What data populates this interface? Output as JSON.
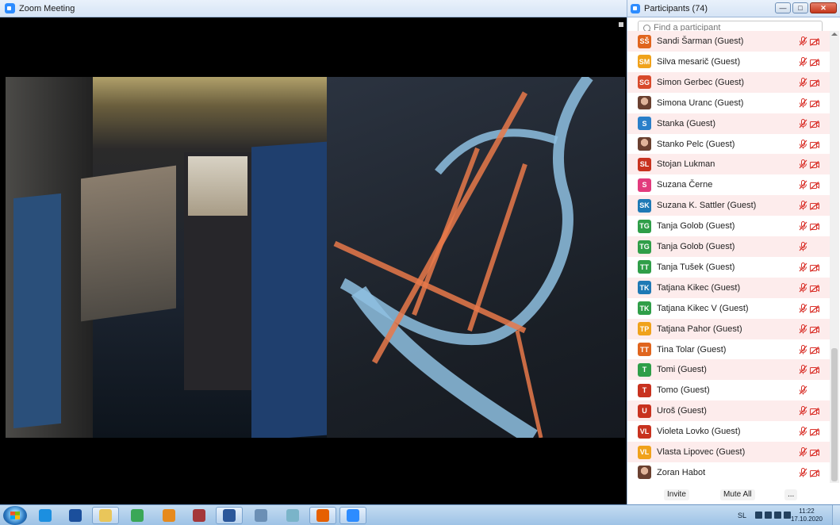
{
  "meeting_window": {
    "title": "Zoom Meeting"
  },
  "participants_panel": {
    "title": "Participants (74)",
    "search_placeholder": "Find a participant",
    "participants": [
      {
        "initials": "SŠ",
        "name": "Sandi Šarman (Guest)",
        "color": "#e0651e",
        "mic_muted": true,
        "video_off": true
      },
      {
        "initials": "SM",
        "name": "Silva mesarič (Guest)",
        "color": "#f0a21c",
        "mic_muted": true,
        "video_off": true
      },
      {
        "initials": "SG",
        "name": "Simon Gerbec (Guest)",
        "color": "#d84a2b",
        "mic_muted": true,
        "video_off": true
      },
      {
        "initials": "",
        "name": "Simona Uranc (Guest)",
        "color": "photo",
        "mic_muted": true,
        "video_off": true
      },
      {
        "initials": "S",
        "name": "Stanka (Guest)",
        "color": "#2a7fc9",
        "mic_muted": true,
        "video_off": true
      },
      {
        "initials": "",
        "name": "Stanko Pelc (Guest)",
        "color": "photo",
        "mic_muted": true,
        "video_off": true
      },
      {
        "initials": "SL",
        "name": "Stojan Lukman",
        "color": "#c8321f",
        "mic_muted": true,
        "video_off": true
      },
      {
        "initials": "S",
        "name": "Suzana Černe",
        "color": "#e23b7d",
        "mic_muted": true,
        "video_off": true
      },
      {
        "initials": "SK",
        "name": "Suzana K. Sattler (Guest)",
        "color": "#1e79b5",
        "mic_muted": true,
        "video_off": true
      },
      {
        "initials": "TG",
        "name": "Tanja Golob (Guest)",
        "color": "#2f9e48",
        "mic_muted": true,
        "video_off": true
      },
      {
        "initials": "TG",
        "name": "Tanja Golob (Guest)",
        "color": "#2f9e48",
        "mic_muted": true,
        "video_off": false
      },
      {
        "initials": "TT",
        "name": "Tanja Tušek (Guest)",
        "color": "#2f9e48",
        "mic_muted": true,
        "video_off": true
      },
      {
        "initials": "TK",
        "name": "Tatjana Kikec (Guest)",
        "color": "#1e79b5",
        "mic_muted": true,
        "video_off": true
      },
      {
        "initials": "TK",
        "name": "Tatjana Kikec V (Guest)",
        "color": "#2f9e48",
        "mic_muted": true,
        "video_off": true
      },
      {
        "initials": "TP",
        "name": "Tatjana Pahor (Guest)",
        "color": "#f0a21c",
        "mic_muted": true,
        "video_off": true
      },
      {
        "initials": "TT",
        "name": "Tina Tolar (Guest)",
        "color": "#e0651e",
        "mic_muted": true,
        "video_off": true
      },
      {
        "initials": "T",
        "name": "Tomi (Guest)",
        "color": "#2f9e48",
        "mic_muted": true,
        "video_off": true
      },
      {
        "initials": "T",
        "name": "Tomo (Guest)",
        "color": "#c8321f",
        "mic_muted": true,
        "video_off": false
      },
      {
        "initials": "U",
        "name": "Uroš (Guest)",
        "color": "#c8321f",
        "mic_muted": true,
        "video_off": true
      },
      {
        "initials": "VL",
        "name": "Violeta Lovko (Guest)",
        "color": "#c8321f",
        "mic_muted": true,
        "video_off": true
      },
      {
        "initials": "VL",
        "name": "Vlasta Lipovec (Guest)",
        "color": "#f0a21c",
        "mic_muted": true,
        "video_off": true
      },
      {
        "initials": "",
        "name": "Zoran Habot",
        "color": "photo",
        "mic_muted": true,
        "video_off": true
      }
    ],
    "footer": {
      "invite_label": "Invite",
      "mute_all_label": "Mute All",
      "more_label": "..."
    }
  },
  "taskbar": {
    "apps": [
      {
        "name": "internet-explorer-icon",
        "color": "#1c8fe0"
      },
      {
        "name": "google-earth-icon",
        "color": "#1b4f9c"
      },
      {
        "name": "file-explorer-icon",
        "color": "#e9c65a"
      },
      {
        "name": "chrome-icon",
        "color": "#3aa757"
      },
      {
        "name": "outlook-icon",
        "color": "#e68a1e"
      },
      {
        "name": "access-icon",
        "color": "#a4373a"
      },
      {
        "name": "word-icon",
        "color": "#2b579a"
      },
      {
        "name": "calculator-icon",
        "color": "#6b8fb5"
      },
      {
        "name": "notes-icon",
        "color": "#7ab4c9"
      },
      {
        "name": "firefox-icon",
        "color": "#e66000"
      },
      {
        "name": "zoom-icon",
        "color": "#2d8cff"
      }
    ],
    "language": "SL",
    "time": "11:22",
    "date": "17.10.2020"
  }
}
